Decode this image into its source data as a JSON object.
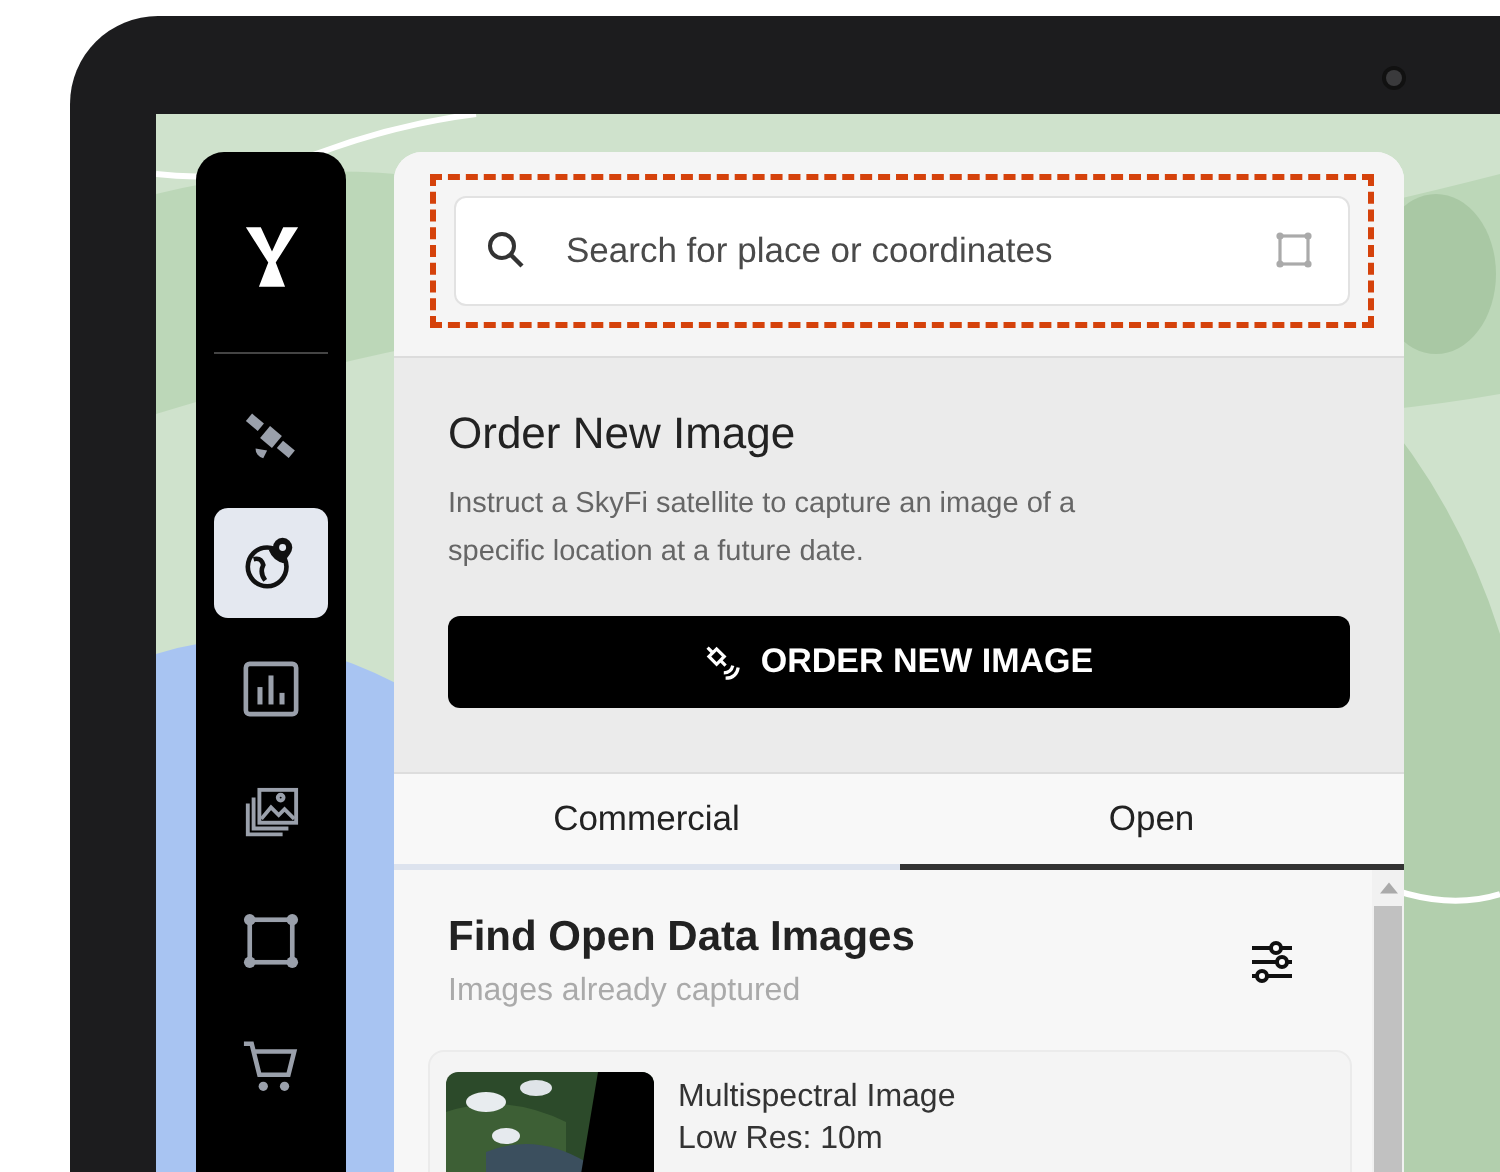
{
  "sidebar": {
    "items": [
      {
        "kind": "satellite",
        "selected": false
      },
      {
        "kind": "globe",
        "selected": true
      },
      {
        "kind": "chart",
        "selected": false
      },
      {
        "kind": "images",
        "selected": false
      },
      {
        "kind": "area",
        "selected": false
      },
      {
        "kind": "cart",
        "selected": false
      }
    ]
  },
  "search": {
    "placeholder": "Search for place or coordinates"
  },
  "order": {
    "title": "Order New Image",
    "description": "Instruct a SkyFi satellite to capture an image of a specific location at a future date.",
    "button": "ORDER NEW IMAGE"
  },
  "tabs": [
    {
      "label": "Commercial",
      "selected": false
    },
    {
      "label": "Open",
      "selected": true
    }
  ],
  "open_data": {
    "title": "Find Open Data Images",
    "subtitle": "Images already captured",
    "results": [
      {
        "kind": "picture",
        "title": "Multispectral Image",
        "resolution": "Low Res: 10m"
      }
    ]
  }
}
